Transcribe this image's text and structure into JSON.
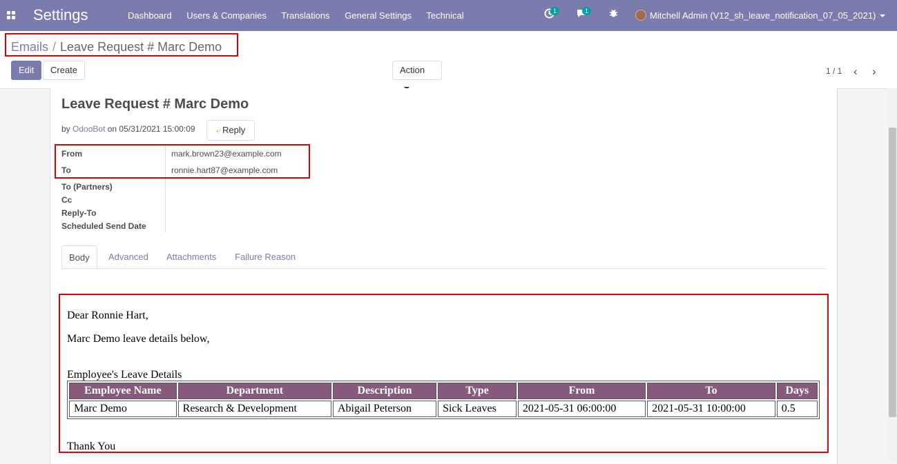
{
  "navbar": {
    "app_title": "Settings",
    "menu": [
      "Dashboard",
      "Users & Companies",
      "Translations",
      "General Settings",
      "Technical"
    ],
    "activity_count": "1",
    "message_count": "1",
    "user": "Mitchell Admin (V12_sh_leave_notification_07_05_2021)"
  },
  "breadcrumb": {
    "parent": "Emails",
    "sep": "/",
    "current": "Leave Request # Marc Demo"
  },
  "control": {
    "edit": "Edit",
    "create": "Create",
    "action": "Action",
    "pager": "1 / 1"
  },
  "mail": {
    "subject": "Leave Request # Marc Demo",
    "by": "by",
    "author": "OdooBot",
    "on": "on 05/31/2021 15:00:09",
    "reply": "Reply",
    "fields": {
      "from_label": "From",
      "from_value": "mark.brown23@example.com",
      "to_label": "To",
      "to_value": "ronnie.hart87@example.com",
      "to_partners_label": "To (Partners)",
      "cc_label": "Cc",
      "reply_to_label": "Reply-To",
      "scheduled_label": "Scheduled Send Date"
    },
    "tabs": [
      "Body",
      "Advanced",
      "Attachments",
      "Failure Reason"
    ],
    "active_tab": "Body"
  },
  "body": {
    "greeting": "Dear Ronnie Hart,",
    "intro": "Marc Demo leave details below,",
    "table_title": "Employee's Leave Details",
    "headers": [
      "Employee Name",
      "Department",
      "Description",
      "Type",
      "From",
      "To",
      "Days"
    ],
    "rows": [
      [
        "Marc Demo",
        "Research & Development",
        "Abigail Peterson",
        "Sick Leaves",
        "2021-05-31 06:00:00",
        "2021-05-31 10:00:00",
        "0.5"
      ]
    ],
    "closing": "Thank You"
  },
  "colors": {
    "brand": "#7c7bad",
    "table_header": "#875a7b",
    "highlight": "#d9000d",
    "badge": "#00a09d"
  }
}
